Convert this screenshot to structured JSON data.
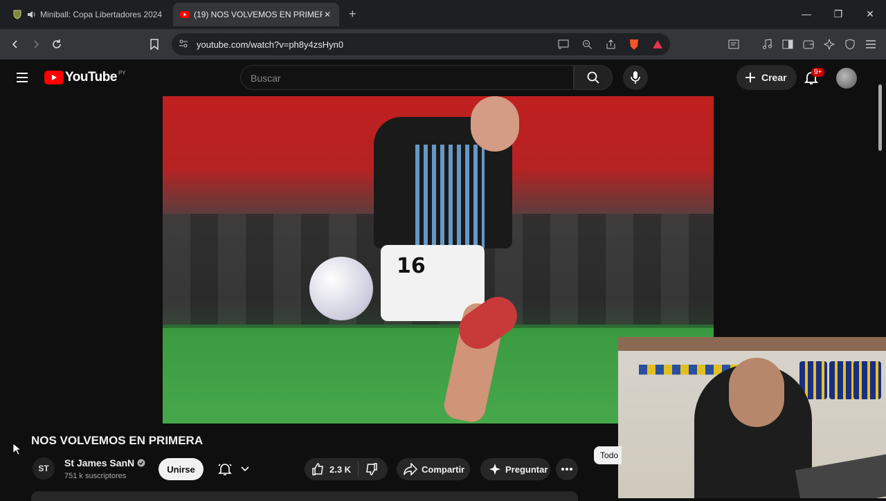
{
  "browser": {
    "tabs": [
      {
        "title": "Miniball: Copa Libertadores 2024",
        "active": false
      },
      {
        "title": "(19) NOS VOLVEMOS EN PRIMER",
        "active": true
      }
    ],
    "url": "youtube.com/watch?v=ph8y4zsHyn0"
  },
  "youtube": {
    "logo_text": "YouTube",
    "logo_country": "PY",
    "search_placeholder": "Buscar",
    "create_label": "Crear",
    "notification_badge": "9+"
  },
  "video": {
    "jersey_number": "16",
    "title": "NOS VOLVEMOS EN PRIMERA",
    "channel": {
      "name": "St James SanN",
      "subscribers": "751 k suscriptores",
      "avatar_text": "ST"
    },
    "join_label": "Unirse",
    "likes": "2.3 K",
    "share_label": "Compartir",
    "ask_label": "Preguntar",
    "chip_label": "Todo"
  },
  "colors": {
    "accent_red": "#ff0000",
    "bg": "#0f0f0f"
  }
}
